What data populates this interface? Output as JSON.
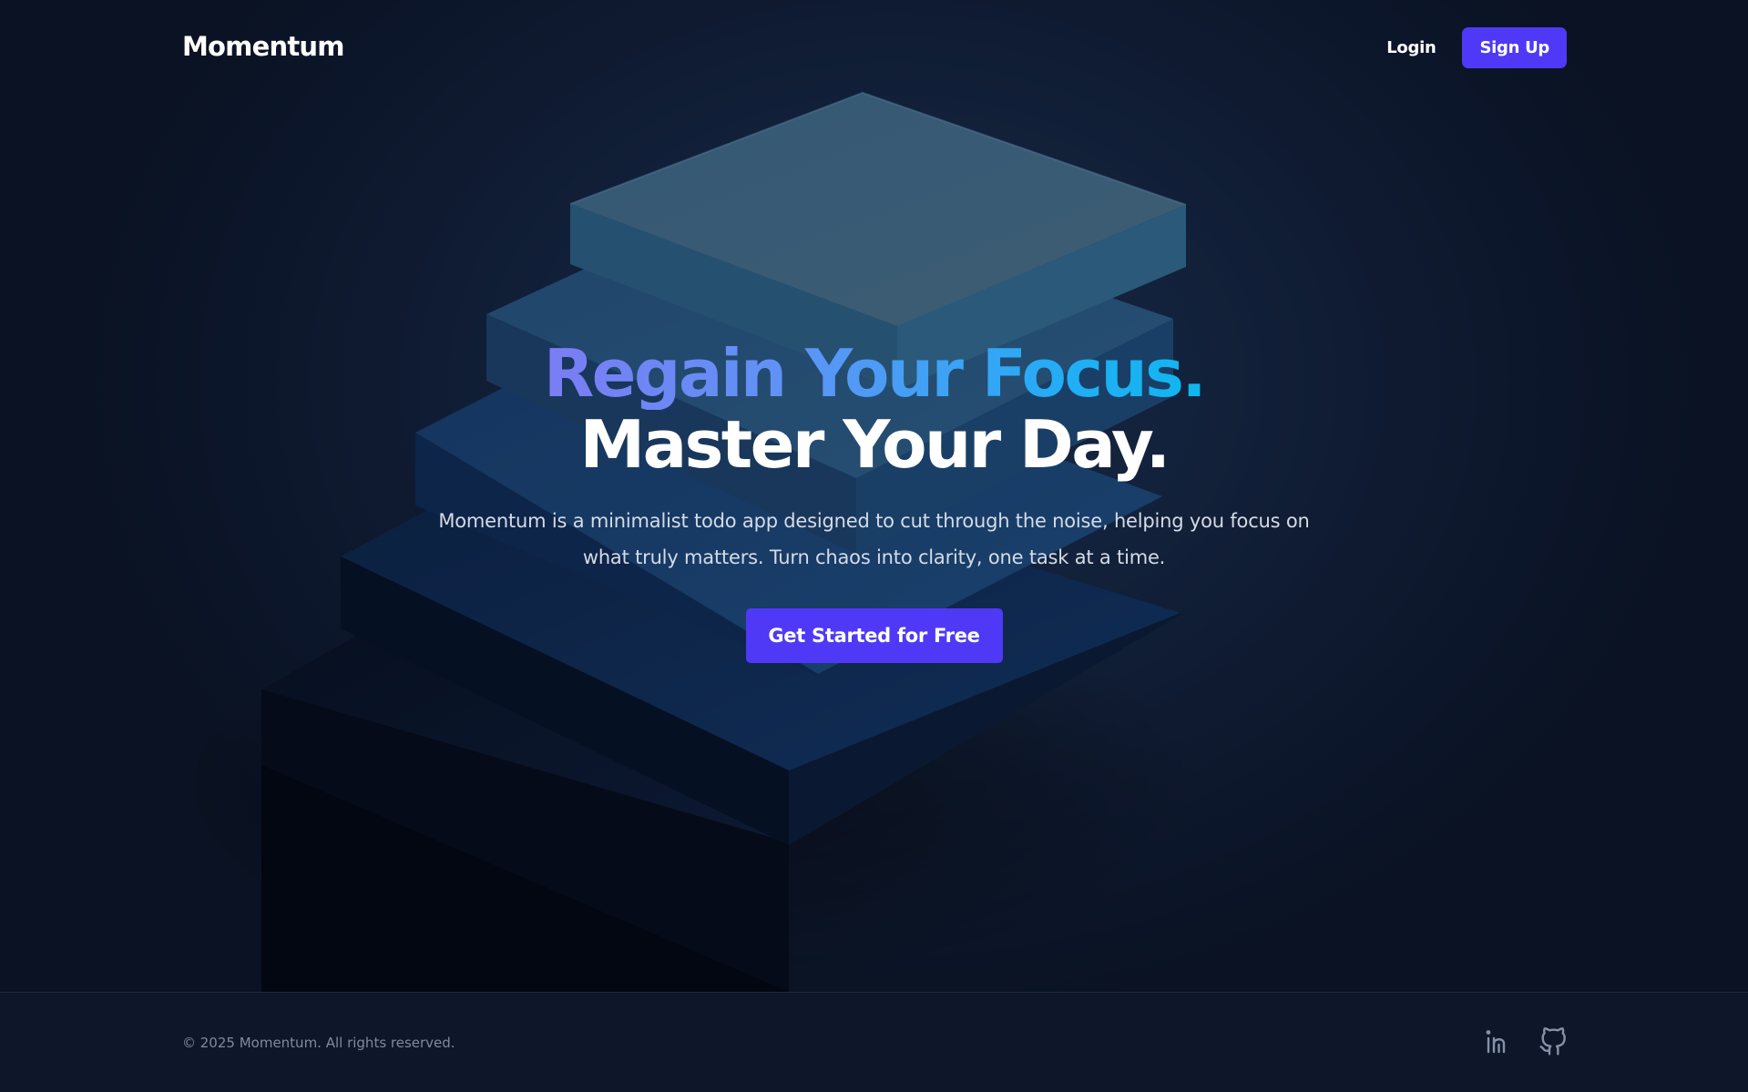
{
  "brand": {
    "name": "Momentum"
  },
  "nav": {
    "login_label": "Login",
    "signup_label": "Sign Up"
  },
  "hero": {
    "headline_line1": "Regain Your Focus.",
    "headline_line2": "Master Your Day.",
    "subtitle": "Momentum is a minimalist todo app designed to cut through the noise, helping you focus on what truly matters. Turn chaos into clarity, one task at a time.",
    "cta_label": "Get Started for Free"
  },
  "footer": {
    "copyright": "© 2025 Momentum. All rights reserved.",
    "socials": [
      {
        "icon": "linkedin-icon"
      },
      {
        "icon": "github-icon"
      }
    ]
  },
  "colors": {
    "primary_button": "#4f39f6",
    "headline_gradient_start": "#7b7cf4",
    "headline_gradient_end": "#0fb7ee",
    "background": "#0b1222",
    "footer_background": "#0e1729"
  }
}
